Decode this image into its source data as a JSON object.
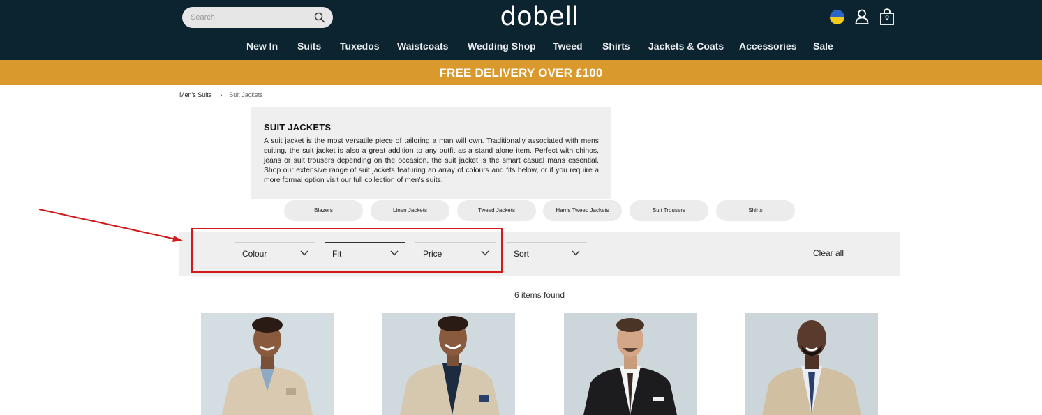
{
  "header": {
    "search_placeholder": "Search",
    "logo": "dobell",
    "bag_count": "0"
  },
  "nav": {
    "items": [
      "New In",
      "Suits",
      "Tuxedos",
      "Waistcoats",
      "Wedding Shop",
      "Tweed",
      "Shirts",
      "Jackets & Coats",
      "Accessories",
      "Sale"
    ]
  },
  "promo": {
    "text": "FREE DELIVERY OVER £100"
  },
  "breadcrumb": {
    "parent": "Men's Suits",
    "separator": "›",
    "current": "Suit Jackets"
  },
  "intro": {
    "title": "SUIT JACKETS",
    "body": "A suit jacket is the most versatile piece of tailoring a man will own. Traditionally associated with mens suiting, the suit jacket is also a great addition to any outfit as a stand alone item. Perfect with chinos, jeans or suit trousers depending on the occasion, the suit jacket is the smart casual mans essential. Shop our extensive range of suit jackets featuring an array of colours and fits below, or if you require a more formal option visit our full collection of ",
    "link_text": "men's suits",
    "end": "."
  },
  "chips": [
    "Blazers",
    "Linen Jackets",
    "Tweed Jackets",
    "Harris Tweed Jackets",
    "Suit Trousers",
    "Shirts"
  ],
  "filters": {
    "colour": "Colour",
    "fit": "Fit",
    "price": "Price",
    "sort": "Sort",
    "clear_all": "Clear all"
  },
  "results": {
    "count_text": "6 items found"
  },
  "colors": {
    "header_bg": "#0c2430",
    "promo_bg": "#d9992c",
    "highlight": "#d21a1a"
  }
}
